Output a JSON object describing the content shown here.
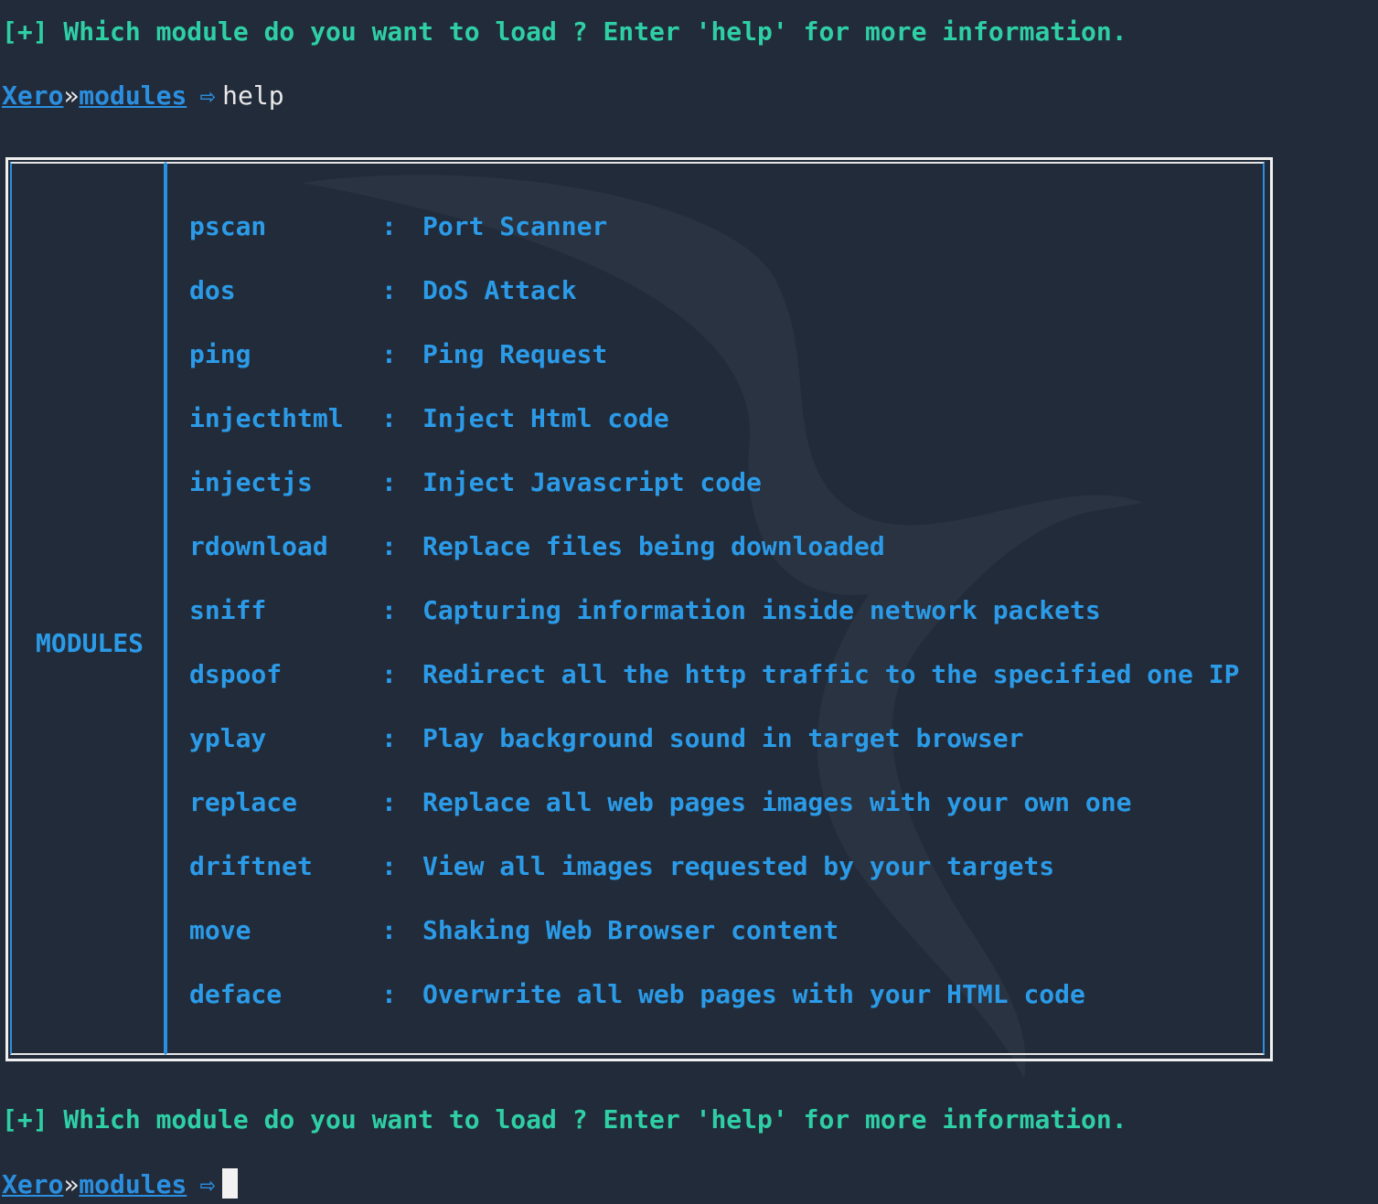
{
  "info_message": "[+] Which module do you want to load ? Enter 'help' for more information.",
  "prompt": {
    "host": "Xero",
    "separator": "»",
    "path": "modules",
    "arrow": "⇨"
  },
  "first_command": "help",
  "modules_label": "MODULES",
  "modules": [
    {
      "name": "pscan",
      "desc": "Port Scanner"
    },
    {
      "name": "dos",
      "desc": "DoS Attack"
    },
    {
      "name": "ping",
      "desc": "Ping Request"
    },
    {
      "name": "injecthtml",
      "desc": "Inject Html code"
    },
    {
      "name": "injectjs",
      "desc": "Inject Javascript code"
    },
    {
      "name": "rdownload",
      "desc": "Replace files being downloaded"
    },
    {
      "name": "sniff",
      "desc": "Capturing information inside network packets"
    },
    {
      "name": "dspoof",
      "desc": "Redirect all the http traffic to the specified one IP"
    },
    {
      "name": "yplay",
      "desc": "Play background sound in target browser"
    },
    {
      "name": "replace",
      "desc": "Replace all web pages images with your own one"
    },
    {
      "name": "driftnet",
      "desc": "View all images requested by your targets"
    },
    {
      "name": "move",
      "desc": "Shaking Web Browser content"
    },
    {
      "name": "deface",
      "desc": "Overwrite all web pages with your HTML code"
    }
  ],
  "colors": {
    "background": "#222b3a",
    "info_text": "#2fcfa6",
    "accent_blue": "#2b9be8",
    "prompt_text": "#e8e8e8"
  }
}
